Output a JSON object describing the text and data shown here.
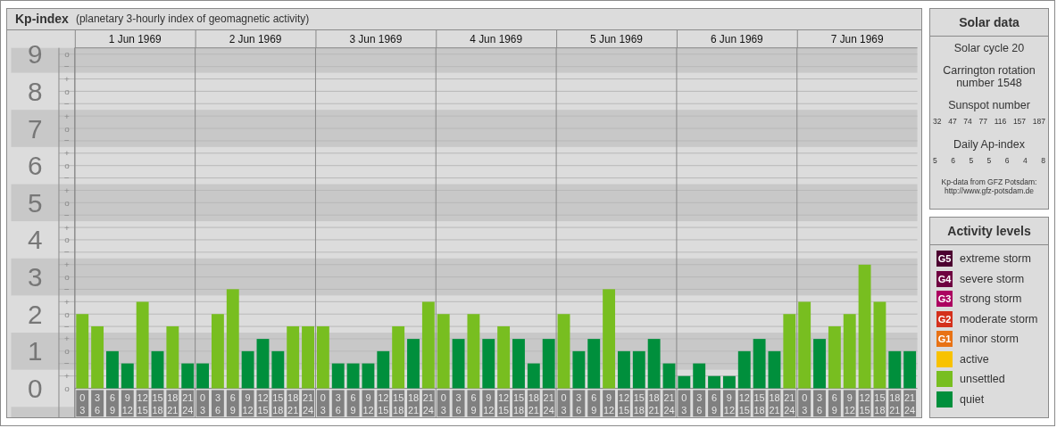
{
  "kp_panel": {
    "title": "Kp-index",
    "subtitle": "(planetary 3-hourly index of geomagnetic activity)",
    "dates": [
      "1 Jun 1969",
      "2 Jun 1969",
      "3 Jun 1969",
      "4 Jun 1969",
      "5 Jun 1969",
      "6 Jun 1969",
      "7 Jun 1969"
    ],
    "sub_ticks": [
      "o",
      "−",
      "+",
      "o",
      "−",
      "+",
      "o",
      "−",
      "+",
      "o",
      "−",
      "+",
      "o",
      "−",
      "+",
      "o",
      "−",
      "+",
      "o",
      "−",
      "+",
      "o",
      "−",
      "+",
      "o",
      "−",
      "+",
      "o"
    ],
    "chart_data": {
      "type": "bar",
      "grid": true,
      "ylim": [
        0,
        9.17
      ],
      "yticks": [
        {
          "value": 0,
          "label": "0"
        },
        {
          "value": 1,
          "label": "1"
        },
        {
          "value": 2,
          "label": "2"
        },
        {
          "value": 3,
          "label": "3"
        },
        {
          "value": 4,
          "label": "4"
        },
        {
          "value": 5,
          "label": "5"
        },
        {
          "value": 6,
          "label": "6"
        },
        {
          "value": 7,
          "label": "7"
        },
        {
          "value": 8,
          "label": "8"
        },
        {
          "value": 9,
          "label": "9"
        }
      ],
      "categories": [
        "0\n3",
        "3\n6",
        "6\n9",
        "9\n12",
        "12\n15",
        "15\n18",
        "18\n21",
        "21\n24",
        "0\n3",
        "3\n6",
        "6\n9",
        "9\n12",
        "12\n15",
        "15\n18",
        "18\n21",
        "21\n24",
        "0\n3",
        "3\n6",
        "6\n9",
        "9\n12",
        "12\n15",
        "15\n18",
        "18\n21",
        "21\n24",
        "0\n3",
        "3\n6",
        "6\n9",
        "9\n12",
        "12\n15",
        "15\n18",
        "18\n21",
        "21\n24",
        "0\n3",
        "3\n6",
        "6\n9",
        "9\n12",
        "12\n15",
        "15\n18",
        "18\n21",
        "21\n24",
        "0\n3",
        "3\n6",
        "6\n9",
        "9\n12",
        "12\n15",
        "15\n18",
        "18\n21",
        "21\n24",
        "0\n3",
        "3\n6",
        "6\n9",
        "9\n12",
        "12\n15",
        "15\n18",
        "18\n21",
        "21\n24"
      ],
      "series": [
        {
          "color": "#78be20",
          "values": [
            2,
            1.67,
            null,
            null,
            2.33,
            null,
            1.67,
            null,
            null,
            2,
            2.67,
            null,
            null,
            null,
            1.67,
            1.67,
            1.67,
            null,
            null,
            null,
            null,
            1.67,
            null,
            2.33,
            2,
            null,
            2,
            null,
            1.67,
            null,
            null,
            null,
            2,
            null,
            null,
            2.67,
            null,
            null,
            null,
            null,
            null,
            null,
            null,
            null,
            null,
            null,
            null,
            2,
            2.33,
            null,
            1.67,
            2,
            3.33,
            2.33,
            null,
            null
          ]
        },
        {
          "color": "#008f3c",
          "values": [
            null,
            null,
            1,
            0.67,
            null,
            1,
            null,
            0.67,
            0.67,
            null,
            null,
            1,
            1.33,
            1,
            null,
            null,
            null,
            0.67,
            0.67,
            0.67,
            1,
            null,
            1.33,
            null,
            null,
            1.33,
            null,
            1.33,
            null,
            1.33,
            0.67,
            1.33,
            null,
            1,
            1.33,
            null,
            1,
            1,
            1.33,
            0.67,
            0.33,
            0.67,
            0.33,
            0.33,
            1,
            1.33,
            1,
            null,
            null,
            1.33,
            null,
            null,
            null,
            null,
            1,
            1
          ]
        }
      ]
    }
  },
  "solar_data": {
    "title": "Solar data",
    "cycle": "Solar cycle 20",
    "rotation": "Carrington rotation number 1548",
    "sunspot_label": "Sunspot number",
    "sunspots": [
      "32",
      "47",
      "74",
      "77",
      "116",
      "157",
      "187"
    ],
    "ap_label": "Daily Ap-index",
    "ap": [
      "5",
      "6",
      "5",
      "5",
      "6",
      "4",
      "8"
    ],
    "source": "Kp-data from GFZ Potsdam:",
    "source_url": "http://www.gfz-potsdam.de"
  },
  "activity_levels": {
    "title": "Activity levels",
    "items": [
      {
        "badge": "G5",
        "label": "extreme storm",
        "color": "#4c0030"
      },
      {
        "badge": "G4",
        "label": "severe storm",
        "color": "#6e0040"
      },
      {
        "badge": "G3",
        "label": "strong storm",
        "color": "#ac0060"
      },
      {
        "badge": "G2",
        "label": "moderate storm",
        "color": "#d4301c"
      },
      {
        "badge": "G1",
        "label": "minor storm",
        "color": "#e87214"
      },
      {
        "label": "active",
        "color": "#f8c200"
      },
      {
        "label": "unsettled",
        "color": "#78be20"
      },
      {
        "label": "quiet",
        "color": "#008f3c"
      }
    ]
  }
}
